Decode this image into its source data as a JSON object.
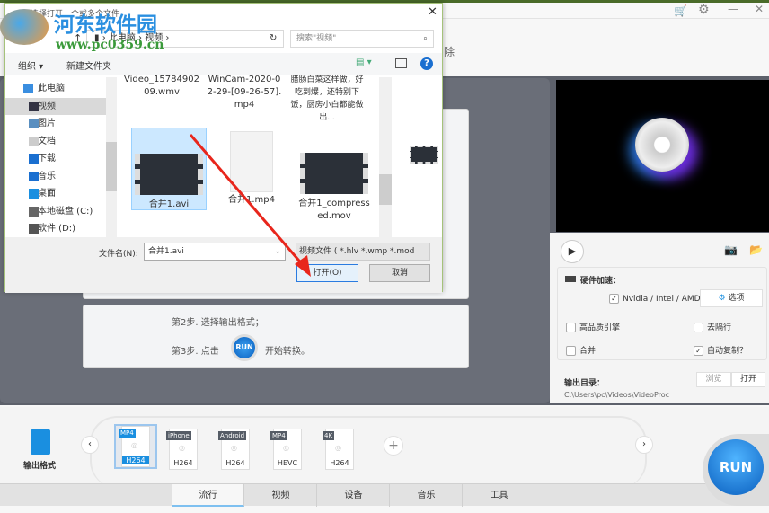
{
  "app": {
    "title_hint": "除",
    "steps": {
      "step2": "第2步. 选择输出格式；",
      "step3_prefix": "第3步. 点击",
      "step3_suffix": "开始转换。",
      "run_small": "RUN"
    },
    "settings": {
      "hw_accel": "硬件加速：",
      "nvidia": "Nvidia / Intel / AMD",
      "nvidia_checked": true,
      "options": "选项",
      "high_quality": "高品质引擎",
      "high_quality_checked": false,
      "deinterlace": "去隔行",
      "deinterlace_checked": false,
      "merge": "合并",
      "merge_checked": false,
      "autocopy": "自动复制？",
      "autocopy_checked": true,
      "output_dir_label": "输出目录：",
      "browse": "浏览",
      "open": "打开",
      "output_path": "C:\\Users\\pc\\Videos\\VideoProc"
    },
    "format": {
      "label": "输出格式",
      "presets": [
        {
          "top": "MP4",
          "bottom": "H264",
          "selected": true
        },
        {
          "top": "iPhone",
          "bottom": "H264"
        },
        {
          "top": "Android",
          "bottom": "H264"
        },
        {
          "top": "MP4",
          "bottom": "HEVC"
        },
        {
          "top": "4K",
          "bottom": "H264"
        }
      ],
      "add": "+"
    },
    "run": "RUN",
    "tabs": [
      "流行",
      "视频",
      "设备",
      "音乐",
      "工具"
    ],
    "active_tab": 0
  },
  "dialog": {
    "title": "选择打开一个或多个文件",
    "breadcrumb": [
      "此电脑",
      "视频"
    ],
    "search_placeholder": "搜索\"视频\"",
    "organize": "组织 ▾",
    "new_folder": "新建文件夹",
    "nav": [
      "此电脑",
      "视频",
      "图片",
      "文档",
      "下载",
      "音乐",
      "桌面",
      "本地磁盘 (C:)",
      "软件 (D:)"
    ],
    "files_top": [
      "Video_1578490209.wmv",
      "WinCam-2020-02-29-[09-26-57].mp4",
      "腊肠白菜这样做，好吃到爆，还特别下饭，厨房小白都能做出..."
    ],
    "files": [
      "合并1.avi",
      "合并1.mp4",
      "合并1_compressed.mov"
    ],
    "filename_label": "文件名(N):",
    "filename": "合并1.avi",
    "filetype": "视频文件 ( *.hlv *.wmp *.mod",
    "open": "打开(O)",
    "cancel": "取消"
  },
  "watermark": {
    "name": "河东软件园",
    "url": "www.pc0359.cn"
  },
  "colors": {
    "accent": "#1a8fe0",
    "arrow": "#e8261c",
    "dark": "#5d616b"
  }
}
